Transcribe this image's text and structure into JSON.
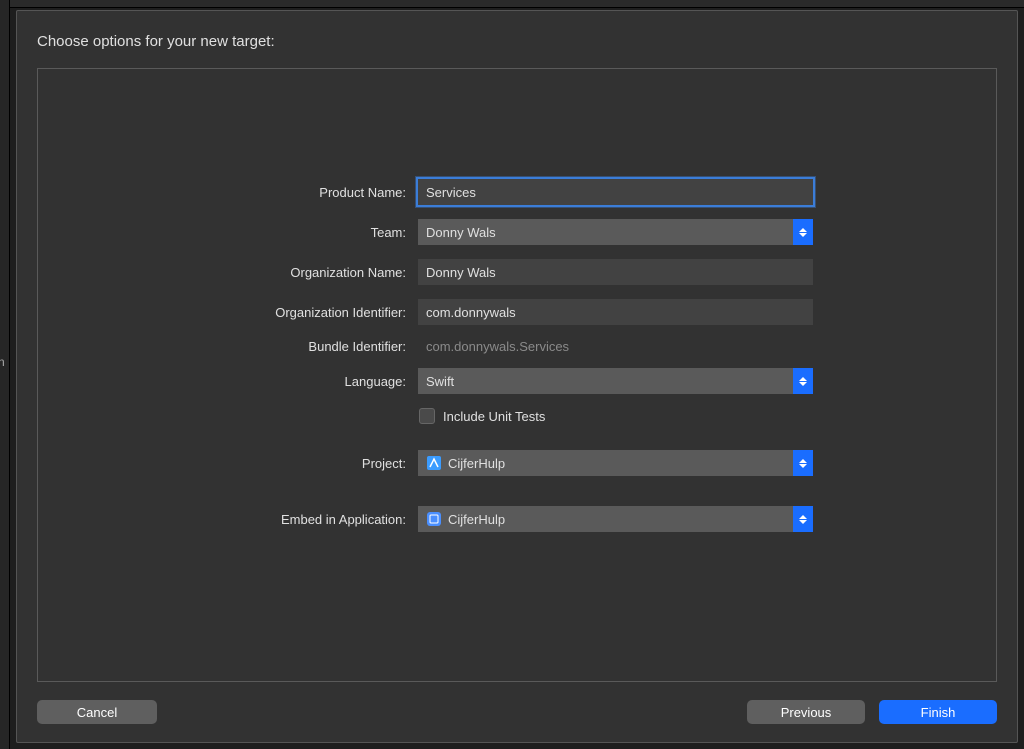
{
  "title": "Choose options for your new target:",
  "form": {
    "productName": {
      "label": "Product Name:",
      "value": "Services"
    },
    "team": {
      "label": "Team:",
      "value": "Donny Wals"
    },
    "orgName": {
      "label": "Organization Name:",
      "value": "Donny Wals"
    },
    "orgIdentifier": {
      "label": "Organization Identifier:",
      "value": "com.donnywals"
    },
    "bundleIdentifier": {
      "label": "Bundle Identifier:",
      "value": "com.donnywals.Services"
    },
    "language": {
      "label": "Language:",
      "value": "Swift"
    },
    "includeUnitTests": {
      "label": "Include Unit Tests",
      "checked": false
    },
    "project": {
      "label": "Project:",
      "value": "CijferHulp"
    },
    "embedInApp": {
      "label": "Embed in Application:",
      "value": "CijferHulp"
    }
  },
  "buttons": {
    "cancel": "Cancel",
    "previous": "Previous",
    "finish": "Finish"
  }
}
